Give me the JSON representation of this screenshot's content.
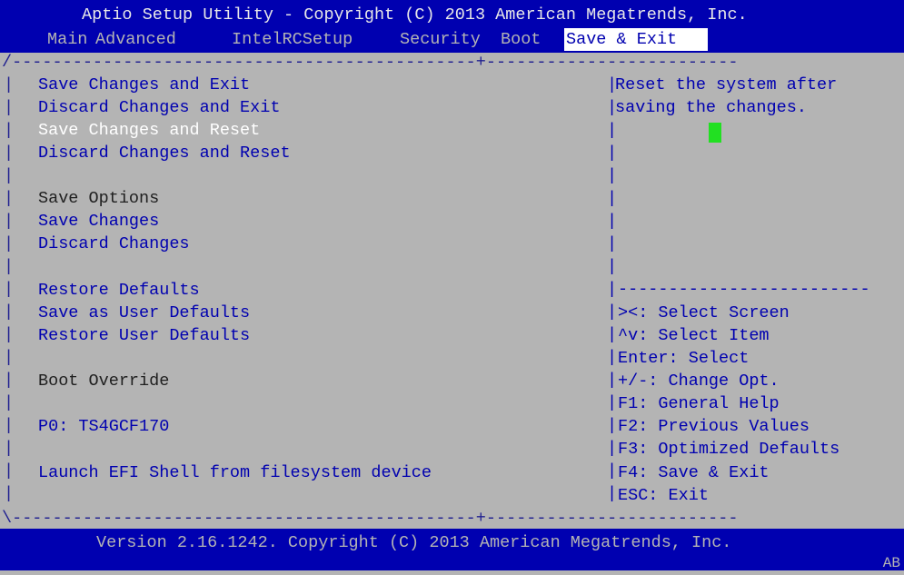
{
  "header": {
    "title": "Aptio Setup Utility - Copyright (C) 2013 American Megatrends, Inc.",
    "tabs": [
      "Main",
      "Advanced",
      "IntelRCSetup",
      "Security",
      "Boot",
      "Save & Exit"
    ],
    "active_tab": "Save & Exit"
  },
  "menu": {
    "items": [
      {
        "label": "Save Changes and Exit"
      },
      {
        "label": "Discard Changes and Exit"
      },
      {
        "label": "Save Changes and Reset",
        "selected": true
      },
      {
        "label": "Discard Changes and Reset"
      },
      {
        "label": "Save Options"
      },
      {
        "label": "Save Changes"
      },
      {
        "label": "Discard Changes"
      },
      {
        "label": "Restore Defaults"
      },
      {
        "label": "Save as User Defaults"
      },
      {
        "label": "Restore User Defaults"
      },
      {
        "label": "Boot Override"
      },
      {
        "label": "P0: TS4GCF170"
      },
      {
        "label": "Launch EFI Shell from filesystem device"
      }
    ]
  },
  "help": {
    "description": [
      "Reset the system after",
      "saving the changes."
    ],
    "keys": [
      "><: Select Screen",
      "^v: Select Item",
      "Enter: Select",
      "+/-: Change Opt.",
      "F1: General Help",
      "F2: Previous Values",
      "F3: Optimized Defaults",
      "F4: Save & Exit",
      "ESC: Exit"
    ]
  },
  "footer": {
    "text": "Version 2.16.1242. Copyright (C) 2013 American Megatrends, Inc.",
    "corner": "AB"
  }
}
